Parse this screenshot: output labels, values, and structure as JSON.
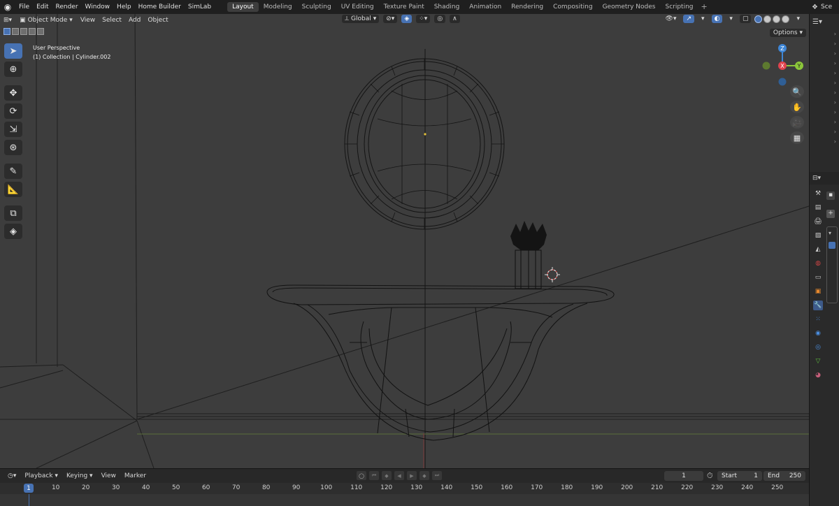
{
  "topbar": {
    "menus": [
      "File",
      "Edit",
      "Render",
      "Window",
      "Help",
      "Home Builder",
      "SimLab"
    ],
    "workspaces": [
      "Layout",
      "Modeling",
      "Sculpting",
      "UV Editing",
      "Texture Paint",
      "Shading",
      "Animation",
      "Rendering",
      "Compositing",
      "Geometry Nodes",
      "Scripting"
    ],
    "active_workspace": "Layout",
    "scene_label": "Sce"
  },
  "viewport": {
    "mode": "Object Mode",
    "menus": [
      "View",
      "Select",
      "Add",
      "Object"
    ],
    "orientation": "Global",
    "options_label": "Options",
    "overlay_line1": "User Perspective",
    "overlay_line2": "(1) Collection | Cylinder.002",
    "gizmo": {
      "z": "Z",
      "x": "X",
      "y": "Y"
    }
  },
  "timeline": {
    "menus": [
      "Playback",
      "Keying",
      "View",
      "Marker"
    ],
    "current_frame": "1",
    "start_label": "Start",
    "start_value": "1",
    "end_label": "End",
    "end_value": "250",
    "ruler_current": "1",
    "ruler_ticks": [
      "10",
      "20",
      "30",
      "40",
      "50",
      "60",
      "70",
      "80",
      "90",
      "100",
      "110",
      "120",
      "130",
      "140",
      "150",
      "160",
      "170",
      "180",
      "190",
      "200",
      "210",
      "220",
      "230",
      "240",
      "250"
    ]
  },
  "colors": {
    "accent": "#4772b3",
    "viewport_bg": "#3d3d3d",
    "axis_x": "#e0434e",
    "axis_y": "#8bc63a",
    "axis_z": "#3e86d6"
  }
}
